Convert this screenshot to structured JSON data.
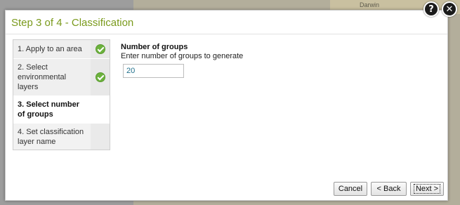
{
  "dialog": {
    "title": "Step 3 of 4 - Classification"
  },
  "steps": [
    {
      "label": "1. Apply to an area",
      "status": "done"
    },
    {
      "label": "2. Select environmental layers",
      "status": "done"
    },
    {
      "label": "3. Select number of groups",
      "status": "current"
    },
    {
      "label": "4. Set classification layer name",
      "status": "pending"
    }
  ],
  "form": {
    "title": "Number of groups",
    "description": "Enter number of groups to generate",
    "value": "20"
  },
  "buttons": {
    "cancel": "Cancel",
    "back": "< Back",
    "next": "Next >"
  },
  "icons": {
    "help": "?",
    "close": "✕"
  },
  "map": {
    "label": "Darwin"
  },
  "colors": {
    "accent": "#7a9a1c",
    "check": "#6cb23d"
  }
}
